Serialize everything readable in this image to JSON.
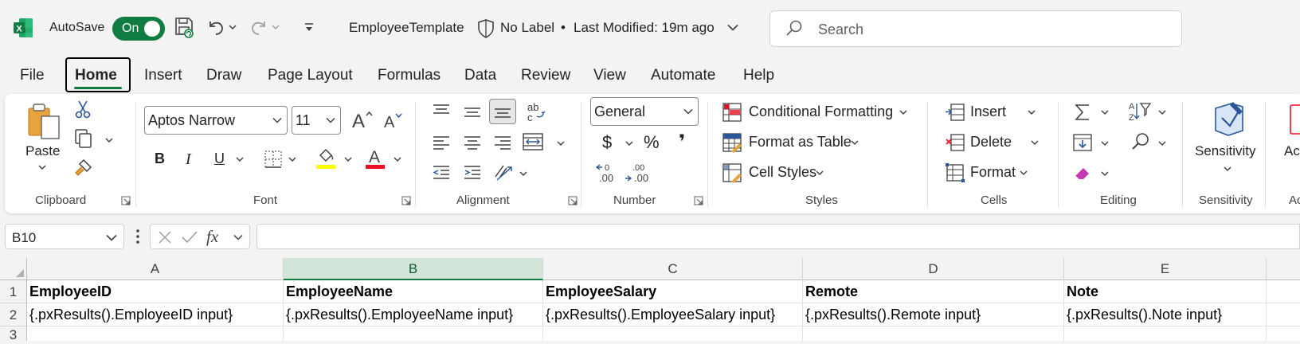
{
  "titlebar": {
    "autosave_label": "AutoSave",
    "autosave_state": "On",
    "document_name": "EmployeeTemplate",
    "sensitivity_label": "No Label",
    "bullet": "•",
    "last_modified": "Last Modified: 19m ago",
    "search_placeholder": "Search"
  },
  "tabs": [
    "File",
    "Home",
    "Insert",
    "Draw",
    "Page Layout",
    "Formulas",
    "Data",
    "Review",
    "View",
    "Automate",
    "Help"
  ],
  "ribbon": {
    "clipboard": {
      "label": "Clipboard",
      "paste": "Paste"
    },
    "font": {
      "label": "Font",
      "font_name": "Aptos Narrow",
      "font_size": "11",
      "bold": "B",
      "italic": "I",
      "underline": "U"
    },
    "alignment": {
      "label": "Alignment"
    },
    "number": {
      "label": "Number",
      "format": "General",
      "currency": "$",
      "percent": "%",
      "comma": "❜",
      "inc_decimal": ".00",
      "dec_decimal": ".00"
    },
    "styles": {
      "label": "Styles",
      "conditional_formatting": "Conditional Formatting",
      "format_as_table": "Format as Table",
      "cell_styles": "Cell Styles"
    },
    "cells": {
      "label": "Cells",
      "insert": "Insert",
      "delete": "Delete",
      "format": "Format"
    },
    "editing": {
      "label": "Editing"
    },
    "sensitivity": {
      "label": "Sensitivity",
      "button": "Sensitivity"
    },
    "overflow": {
      "label": "Ac"
    }
  },
  "formula_bar": {
    "name_box": "B10",
    "fx": "fx",
    "formula": ""
  },
  "sheet": {
    "columns": [
      "A",
      "B",
      "C",
      "D",
      "E"
    ],
    "rows": [
      "1",
      "2",
      "3"
    ],
    "cells": [
      [
        "EmployeeID",
        "EmployeeName",
        "EmployeeSalary",
        "Remote",
        "Note"
      ],
      [
        "{.pxResults().EmployeeID input}",
        "{.pxResults().EmployeeName input}",
        "{.pxResults().EmployeeSalary input}",
        "{.pxResults().Remote input}",
        "{.pxResults().Note input}"
      ]
    ]
  },
  "colors": {
    "excel_green": "#107c41",
    "font_highlight": "#ffff00",
    "font_color": "#e81123"
  }
}
